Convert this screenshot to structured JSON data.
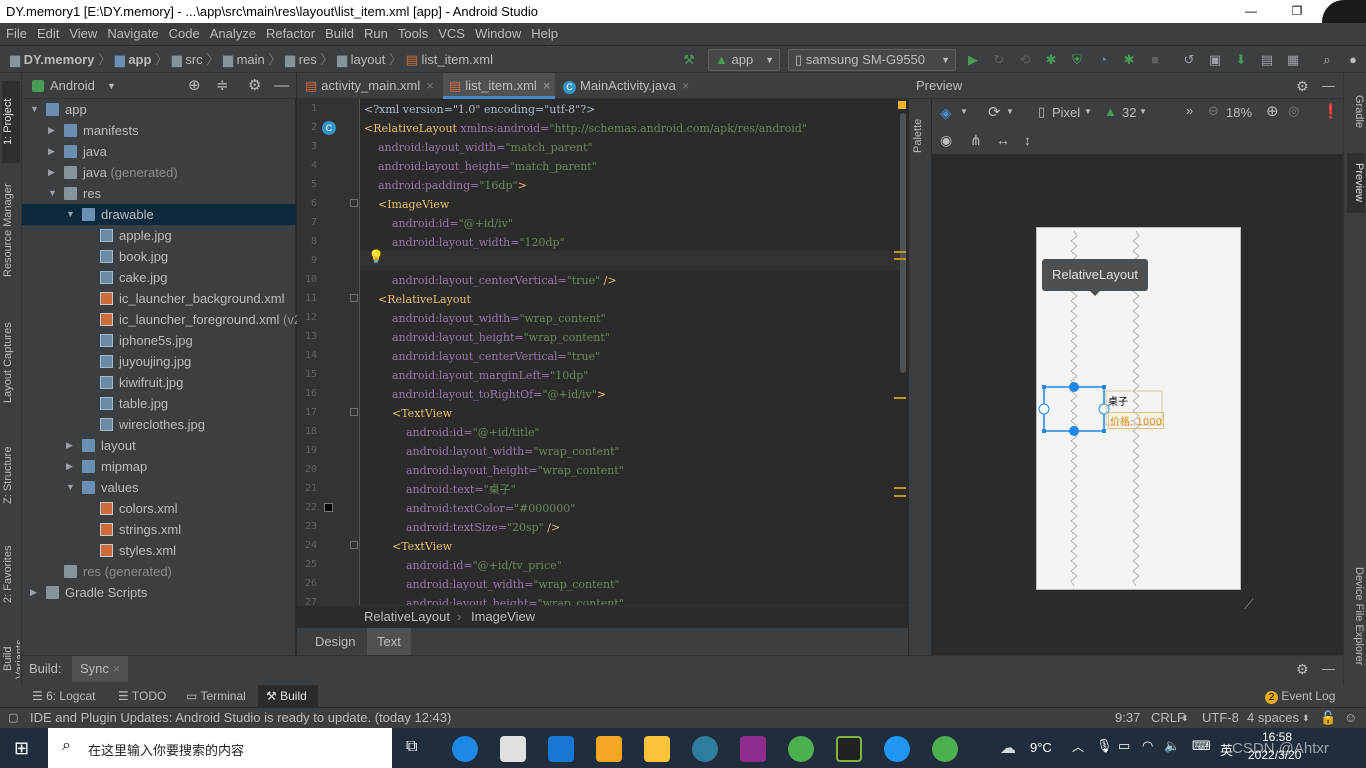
{
  "window": {
    "title": "DY.memory1 [E:\\DY.memory] - ...\\app\\src\\main\\res\\layout\\list_item.xml [app] - Android Studio"
  },
  "menu": [
    "File",
    "Edit",
    "View",
    "Navigate",
    "Code",
    "Analyze",
    "Refactor",
    "Build",
    "Run",
    "Tools",
    "VCS",
    "Window",
    "Help"
  ],
  "nav": {
    "crumbs": [
      "DY.memory",
      "app",
      "src",
      "main",
      "res",
      "layout",
      "list_item.xml"
    ],
    "run_config": "app",
    "device": "samsung SM-G9550"
  },
  "left_tabs": [
    "1: Project",
    "Resource Manager",
    "Layout Captures",
    "Z: Structure",
    "2: Favorites",
    "Build Variants"
  ],
  "project": {
    "view": "Android",
    "tree": [
      {
        "label": "app",
        "depth": 0,
        "exp": true,
        "icon": "folder-blue"
      },
      {
        "label": "manifests",
        "depth": 1,
        "exp": false,
        "icon": "folder-blue"
      },
      {
        "label": "java",
        "depth": 1,
        "exp": false,
        "icon": "folder-blue"
      },
      {
        "label": "java",
        "suffix": " (generated)",
        "depth": 1,
        "exp": false,
        "icon": "folder-gen"
      },
      {
        "label": "res",
        "depth": 1,
        "exp": true,
        "icon": "folder"
      },
      {
        "label": "drawable",
        "depth": 2,
        "exp": true,
        "icon": "folder-blue",
        "selected": true
      },
      {
        "label": "apple.jpg",
        "depth": 3,
        "icon": "img"
      },
      {
        "label": "book.jpg",
        "depth": 3,
        "icon": "img"
      },
      {
        "label": "cake.jpg",
        "depth": 3,
        "icon": "img"
      },
      {
        "label": "ic_launcher_background.xml",
        "depth": 3,
        "icon": "xml-red"
      },
      {
        "label": "ic_launcher_foreground.xml",
        "suffix": " (v24)",
        "depth": 3,
        "icon": "xml-red"
      },
      {
        "label": "iphone5s.jpg",
        "depth": 3,
        "icon": "img"
      },
      {
        "label": "juyoujing.jpg",
        "depth": 3,
        "icon": "img"
      },
      {
        "label": "kiwifruit.jpg",
        "depth": 3,
        "icon": "img"
      },
      {
        "label": "table.jpg",
        "depth": 3,
        "icon": "img"
      },
      {
        "label": "wireclothes.jpg",
        "depth": 3,
        "icon": "img"
      },
      {
        "label": "layout",
        "depth": 2,
        "exp": false,
        "icon": "folder-blue"
      },
      {
        "label": "mipmap",
        "depth": 2,
        "exp": false,
        "icon": "folder-blue"
      },
      {
        "label": "values",
        "depth": 2,
        "exp": true,
        "icon": "folder-blue"
      },
      {
        "label": "colors.xml",
        "depth": 3,
        "icon": "xml-red"
      },
      {
        "label": "strings.xml",
        "depth": 3,
        "icon": "xml-red"
      },
      {
        "label": "styles.xml",
        "depth": 3,
        "icon": "xml-red"
      },
      {
        "label": "res (generated)",
        "depth": 1,
        "icon": "folder",
        "muted": true
      },
      {
        "label": "Gradle Scripts",
        "depth": 0,
        "exp": false,
        "icon": "gradle"
      }
    ]
  },
  "editor": {
    "tabs": [
      "activity_main.xml",
      "list_item.xml",
      "MainActivity.java"
    ],
    "active_tab": 1,
    "lines": [
      [
        [
          "txt",
          "<?xml version=\"1.0\" encoding=\"utf-8\"?>"
        ]
      ],
      [
        [
          "tag",
          "<RelativeLayout "
        ],
        [
          "attr",
          "xmlns:android="
        ],
        [
          "val",
          "\"http://schemas.android.com/apk/res/android\""
        ]
      ],
      [
        [
          "txt",
          "    "
        ],
        [
          "attr",
          "android:layout_width="
        ],
        [
          "val",
          "\"match_parent\""
        ]
      ],
      [
        [
          "txt",
          "    "
        ],
        [
          "attr",
          "android:layout_height="
        ],
        [
          "val",
          "\"match_parent\""
        ]
      ],
      [
        [
          "txt",
          "    "
        ],
        [
          "attr",
          "android:padding="
        ],
        [
          "val",
          "\"16dp\""
        ],
        [
          "tag",
          ">"
        ]
      ],
      [
        [
          "txt",
          "    "
        ],
        [
          "tag",
          "<ImageView"
        ]
      ],
      [
        [
          "txt",
          "        "
        ],
        [
          "attr",
          "android:id="
        ],
        [
          "val",
          "\"@+id/iv\""
        ]
      ],
      [
        [
          "txt",
          "        "
        ],
        [
          "attr",
          "android:layout_width="
        ],
        [
          "val",
          "\"120dp\""
        ]
      ],
      [
        [
          "txt",
          "        "
        ],
        [
          "attr",
          "android:layout_height="
        ],
        [
          "val",
          "\"90dp\""
        ]
      ],
      [
        [
          "txt",
          "        "
        ],
        [
          "attr",
          "android:layout_centerVertical="
        ],
        [
          "val",
          "\"true\""
        ],
        [
          "tag",
          " />"
        ]
      ],
      [
        [
          "txt",
          "    "
        ],
        [
          "tag",
          "<RelativeLayout"
        ]
      ],
      [
        [
          "txt",
          "        "
        ],
        [
          "attr",
          "android:layout_width="
        ],
        [
          "val",
          "\"wrap_content\""
        ]
      ],
      [
        [
          "txt",
          "        "
        ],
        [
          "attr",
          "android:layout_height="
        ],
        [
          "val",
          "\"wrap_content\""
        ]
      ],
      [
        [
          "txt",
          "        "
        ],
        [
          "attr",
          "android:layout_centerVertical="
        ],
        [
          "val",
          "\"true\""
        ]
      ],
      [
        [
          "txt",
          "        "
        ],
        [
          "attr",
          "android:layout_marginLeft="
        ],
        [
          "val",
          "\"10dp\""
        ]
      ],
      [
        [
          "txt",
          "        "
        ],
        [
          "attr",
          "android:layout_toRightOf="
        ],
        [
          "val",
          "\"@+id/iv\""
        ],
        [
          "tag",
          ">"
        ]
      ],
      [
        [
          "txt",
          "        "
        ],
        [
          "tag",
          "<TextView"
        ]
      ],
      [
        [
          "txt",
          "            "
        ],
        [
          "attr",
          "android:id="
        ],
        [
          "val",
          "\"@+id/title\""
        ]
      ],
      [
        [
          "txt",
          "            "
        ],
        [
          "attr",
          "android:layout_width="
        ],
        [
          "val",
          "\"wrap_content\""
        ]
      ],
      [
        [
          "txt",
          "            "
        ],
        [
          "attr",
          "android:layout_height="
        ],
        [
          "val",
          "\"wrap_content\""
        ]
      ],
      [
        [
          "txt",
          "            "
        ],
        [
          "attr",
          "android:text="
        ],
        [
          "val",
          "\"桌子\""
        ]
      ],
      [
        [
          "txt",
          "            "
        ],
        [
          "attr",
          "android:textColor="
        ],
        [
          "val",
          "\"#000000\""
        ]
      ],
      [
        [
          "txt",
          "            "
        ],
        [
          "attr",
          "android:textSize="
        ],
        [
          "val",
          "\"20sp\""
        ],
        [
          "tag",
          " />"
        ]
      ],
      [
        [
          "txt",
          "        "
        ],
        [
          "tag",
          "<TextView"
        ]
      ],
      [
        [
          "txt",
          "            "
        ],
        [
          "attr",
          "android:id="
        ],
        [
          "val",
          "\"@+id/tv_price\""
        ]
      ],
      [
        [
          "txt",
          "            "
        ],
        [
          "attr",
          "android:layout_width="
        ],
        [
          "val",
          "\"wrap_content\""
        ]
      ],
      [
        [
          "txt",
          "            "
        ],
        [
          "attr",
          "android:layout_height="
        ],
        [
          "val",
          "\"wrap_content\""
        ]
      ]
    ]
  },
  "breadcrumb_footer": [
    "RelativeLayout",
    "ImageView"
  ],
  "design_tabs": [
    "Design",
    "Text"
  ],
  "preview": {
    "title": "Preview",
    "palette": "Palette",
    "device": "Pixel",
    "api": "32",
    "zoom": "18%",
    "tooltip": "RelativeLayout",
    "item_title": "桌子",
    "item_price": "价格: 1000"
  },
  "right_tabs": [
    "Gradle",
    "Preview",
    "Device File Explorer"
  ],
  "build": {
    "label": "Build:",
    "tab": "Sync"
  },
  "bottom_tools": [
    "6: Logcat",
    "TODO",
    "Terminal",
    "Build"
  ],
  "event_log": {
    "count": "2",
    "label": "Event Log"
  },
  "status": {
    "message": "IDE and Plugin Updates: Android Studio is ready to update. (today 12:43)",
    "position": "9:37",
    "line_sep": "CRLF",
    "encoding": "UTF-8",
    "indent": "4 spaces"
  },
  "taskbar": {
    "search_placeholder": "在这里输入你要搜索的内容",
    "weather": "9°C",
    "ime": "英",
    "time": "16:58",
    "date": "2022/3/20",
    "watermark": "CSDN @Ahtxr"
  },
  "colors": {
    "accent": "#4a88c7",
    "selection": "#0d293e",
    "tag": "#e8bf6a",
    "attr": "#9876aa",
    "value": "#6a8759",
    "run_green": "#499c54"
  }
}
